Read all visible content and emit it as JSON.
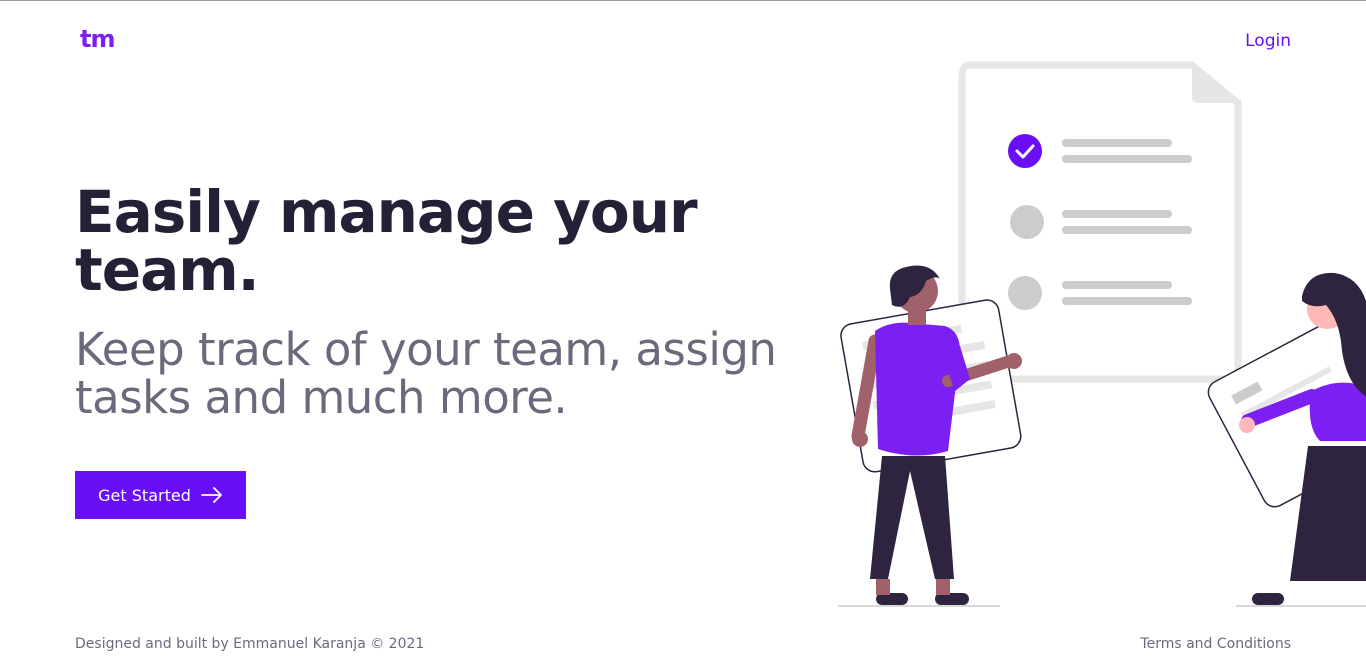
{
  "header": {
    "logo_text": "tm",
    "login_label": "Login"
  },
  "hero": {
    "title": "Easily manage your team.",
    "subtitle": "Keep track of your team, assign tasks and much more.",
    "cta_label": "Get Started",
    "cta_icon": "arrow-right-icon"
  },
  "illustration": {
    "checklist_items": [
      {
        "status": "checked"
      },
      {
        "status": "unchecked"
      },
      {
        "status": "unchecked"
      }
    ]
  },
  "footer": {
    "credit": "Designed and built by Emmanuel Karanja © 2021",
    "terms_label": "Terms and Conditions"
  },
  "colors": {
    "accent": "#6a0ff5",
    "heading": "#232136",
    "muted": "#6b6a7d",
    "figure_purple": "#7b1ff2",
    "figure_dark": "#2f2440",
    "skin": "#a0616a",
    "doc_gray": "#e6e6e6",
    "line_gray": "#cccccc"
  }
}
